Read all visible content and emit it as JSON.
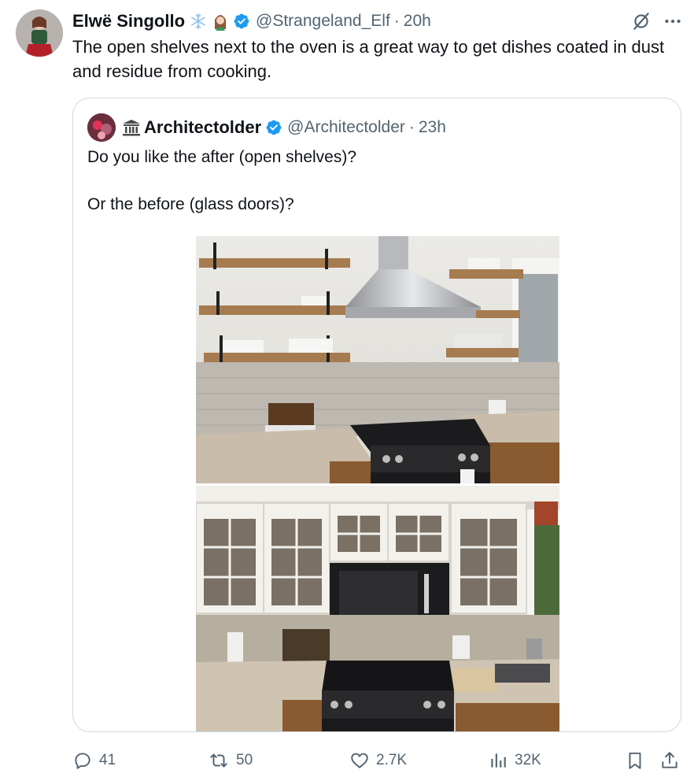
{
  "tweet": {
    "display_name": "Elwë Singollo",
    "handle": "@Strangeland_Elf",
    "separator": "·",
    "time": "20h",
    "text": "The open shelves next to the oven is a great way to get dishes coated in dust and residue from cooking.",
    "badge_emojis": [
      "snowflake-icon",
      "woman-elf-icon"
    ],
    "verified": true
  },
  "quote": {
    "display_name": "Architectolder",
    "handle": "@Architectolder",
    "separator": "·",
    "time": "23h",
    "line1": "Do you like the after (open shelves)?",
    "line2": "Or the before (glass doors)?",
    "verified": true
  },
  "metrics": {
    "replies": "41",
    "reposts": "50",
    "likes": "2.7K",
    "views": "32K"
  },
  "colors": {
    "text_primary": "#0f1419",
    "text_secondary": "#536471",
    "verified_blue": "#1d9bf0",
    "card_border": "#cfd9de"
  }
}
